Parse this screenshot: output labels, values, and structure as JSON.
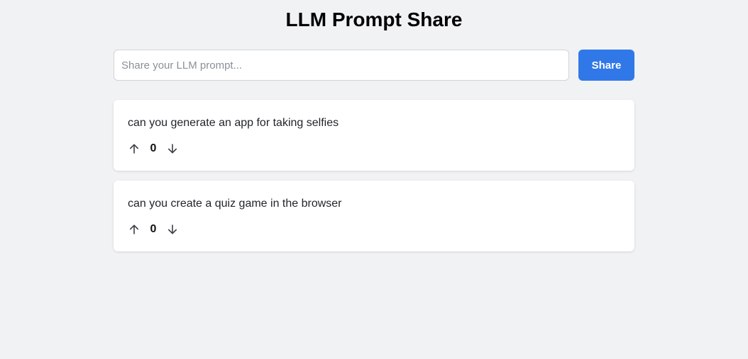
{
  "header": {
    "title": "LLM Prompt Share"
  },
  "compose": {
    "placeholder": "Share your LLM prompt...",
    "value": "",
    "share_label": "Share",
    "share_color": "#3078e8"
  },
  "posts": [
    {
      "text": "can you generate an app for taking selfies",
      "votes": "0",
      "upvote_icon": "arrow-up-icon",
      "downvote_icon": "arrow-down-icon"
    },
    {
      "text": "can you create a quiz game in the browser",
      "votes": "0",
      "upvote_icon": "arrow-up-icon",
      "downvote_icon": "arrow-down-icon"
    }
  ]
}
